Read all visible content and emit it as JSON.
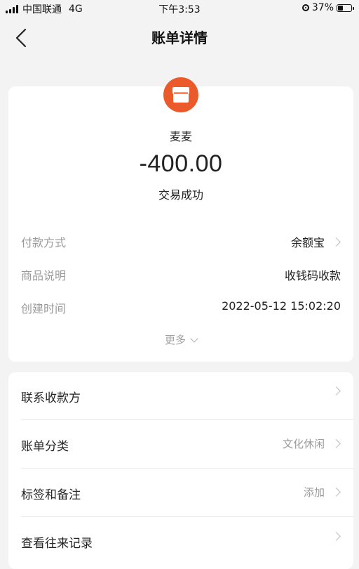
{
  "status_bar": {
    "carrier": "中国联通",
    "network": "4G",
    "time": "下午3:53",
    "battery": "37%"
  },
  "nav": {
    "title": "账单详情"
  },
  "transaction": {
    "merchant": "麦麦",
    "amount": "-400.00",
    "status": "交易成功"
  },
  "details": {
    "payment_method_label": "付款方式",
    "payment_method_value": "余额宝",
    "description_label": "商品说明",
    "description_value": "收钱码收款",
    "created_label": "创建时间",
    "created_value": "2022-05-12 15:02:20",
    "more_label": "更多"
  },
  "menu": {
    "contact_label": "联系收款方",
    "category_label": "账单分类",
    "category_value": "文化休闲",
    "tags_label": "标签和备注",
    "tags_value": "添加",
    "history_label": "查看往来记录"
  },
  "colors": {
    "brand": "#ea5a2a"
  },
  "icons": [
    "back-icon",
    "store-icon",
    "chevron-right-icon",
    "chevron-down-icon",
    "rotation-lock-icon",
    "battery-icon",
    "signal-icon"
  ]
}
